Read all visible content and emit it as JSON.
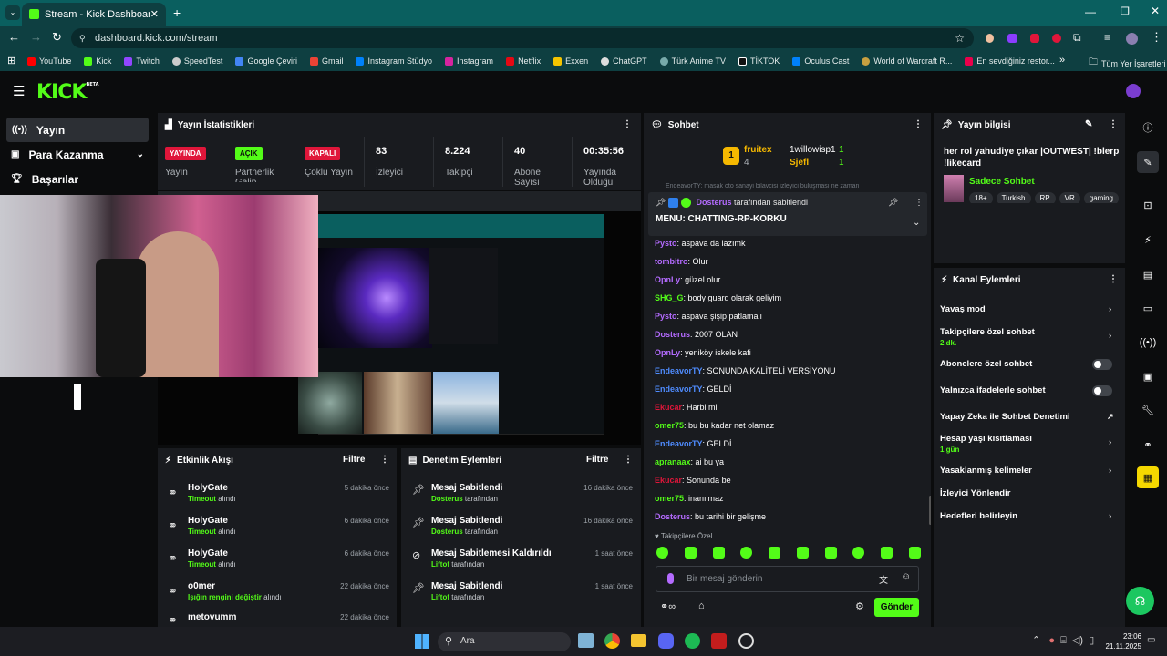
{
  "browser": {
    "tab_title": "Stream - Kick Dashboard",
    "url": "dashboard.kick.com/stream",
    "bookmarks": [
      "YouTube",
      "Kick",
      "Twitch",
      "SpeedTest",
      "Google Çeviri",
      "Gmail",
      "Instagram Stüdyo",
      "Instagram",
      "Netflix",
      "Exxen",
      "ChatGPT",
      "Türk Anime TV",
      "TİKTOK",
      "Oculus Cast",
      "World of Warcraft R...",
      "En sevdiğiniz restor..."
    ],
    "bookmarks_all": "Tüm Yer İşaretleri"
  },
  "app": {
    "logo": "KICK",
    "beta": "BETA"
  },
  "sidebar": {
    "items": [
      {
        "label": "Yayın",
        "icon": "broadcast-icon"
      },
      {
        "label": "Para Kazanma",
        "icon": "money-icon"
      },
      {
        "label": "Başarılar",
        "icon": "trophy-icon"
      }
    ]
  },
  "stats": {
    "title": "Yayın İstatistikleri",
    "items": [
      {
        "badge": "YAYINDA",
        "label": "Yayın",
        "color": "#e0163a"
      },
      {
        "badge": "AÇIK",
        "label": "Partnerlik Galip",
        "color": "#53fc18"
      },
      {
        "badge": "KAPALI",
        "label": "Çoklu Yayın",
        "color": "#e0163a"
      },
      {
        "value": "83",
        "label": "İzleyici"
      },
      {
        "value": "8.224",
        "label": "Takipçi"
      },
      {
        "value": "40",
        "label": "Abone Sayısı"
      },
      {
        "value": "00:35:56",
        "label": "Yayında Olduğu"
      }
    ]
  },
  "activity": {
    "title": "Etkinlik Akışı",
    "filter": "Filtre",
    "items": [
      {
        "user": "HolyGate",
        "action": "Timeout",
        "suffix": "alındı",
        "time": "5 dakika önce"
      },
      {
        "user": "HolyGate",
        "action": "Timeout",
        "suffix": "alındı",
        "time": "6 dakika önce"
      },
      {
        "user": "HolyGate",
        "action": "Timeout",
        "suffix": "alındı",
        "time": "6 dakika önce"
      },
      {
        "user": "o0mer",
        "action": "Işığın rengini değiştir",
        "suffix": "alındı",
        "time": "22 dakika önce"
      },
      {
        "user": "metovumm",
        "action": "",
        "suffix": "",
        "time": "22 dakika önce"
      }
    ]
  },
  "moderation": {
    "title": "Denetim Eylemleri",
    "filter": "Filtre",
    "items": [
      {
        "title": "Mesaj Sabitlendi",
        "by": "Dosterus",
        "suffix": "tarafından",
        "time": "16 dakika önce"
      },
      {
        "title": "Mesaj Sabitlendi",
        "by": "Dosterus",
        "suffix": "tarafından",
        "time": "16 dakika önce"
      },
      {
        "title": "Mesaj Sabitlemesi Kaldırıldı",
        "by": "Liftof",
        "suffix": "tarafından",
        "time": "1 saat önce"
      },
      {
        "title": "Mesaj Sabitlendi",
        "by": "Liftof",
        "suffix": "tarafından",
        "time": "1 saat önce"
      }
    ]
  },
  "chat": {
    "title": "Sohbet",
    "leaders": [
      {
        "rank": "1",
        "name": "fruitex",
        "count": "4"
      },
      {
        "name": "1willowisp1",
        "count": "1"
      },
      {
        "name": "Sjefl",
        "count": "1"
      }
    ],
    "overflow_text": "EndeavorTY: masak oto sanayi bilavcisi izleyici buluşması ne zaman",
    "pinned_by": "Dosterus",
    "pinned_suffix": "tarafından sabitlendi",
    "pinned_text": "MENU: CHATTING-RP-KORKU",
    "messages": [
      {
        "name": "Pysto",
        "color": "#b46bff",
        "text": ": aspava da lazımk"
      },
      {
        "name": "tombitro",
        "color": "#b46bff",
        "text": ": Olur"
      },
      {
        "name": "OpnLy",
        "color": "#b46bff",
        "text": ": güzel olur"
      },
      {
        "name": "SHG_G",
        "color": "#53fc18",
        "text": ": body guard olarak geliyim"
      },
      {
        "name": "Pysto",
        "color": "#b46bff",
        "text": ": aspava şişip patlamalı"
      },
      {
        "name": "Dosterus",
        "color": "#b46bff",
        "text": ": 2007 OLAN"
      },
      {
        "name": "OpnLy",
        "color": "#b46bff",
        "text": ": yeniköy iskele kafi"
      },
      {
        "name": "EndeavorTY",
        "color": "#4f8cff",
        "text": ": SONUNDA KALİTELİ VERSİYONU"
      },
      {
        "name": "EndeavorTY",
        "color": "#4f8cff",
        "text": ": GELDİ"
      },
      {
        "name": "Ekucar",
        "color": "#e0163a",
        "text": ": Harbi mi"
      },
      {
        "name": "omer75",
        "color": "#53fc18",
        "text": ": bu bu kadar net olamaz"
      },
      {
        "name": "EndeavorTY",
        "color": "#4f8cff",
        "text": ": GELDİ"
      },
      {
        "name": "apranaax",
        "color": "#53fc18",
        "text": ": ai bu ya"
      },
      {
        "name": "Ekucar",
        "color": "#e0163a",
        "text": ": Sonunda be"
      },
      {
        "name": "omer75",
        "color": "#53fc18",
        "text": ": inanılmaz"
      },
      {
        "name": "Dosterus",
        "color": "#b46bff",
        "text": ": bu tarihi bir gelişme"
      }
    ],
    "followers_only": "Takipçilere Özel",
    "input_placeholder": "Bir mesaj gönderin",
    "send": "Gönder"
  },
  "stream_info": {
    "title": "Yayın bilgisi",
    "stream_title": "her rol yahudiye çıkar |OUTWEST| !blerp !likecard",
    "category": "Sadece Sohbet",
    "tags": [
      "18+",
      "Turkish",
      "RP",
      "VR",
      "gaming"
    ]
  },
  "channel_actions": {
    "title": "Kanal Eylemleri",
    "items": [
      {
        "label": "Yavaş mod",
        "sub": "",
        "control": "chevron"
      },
      {
        "label": "Takipçilere özel sohbet",
        "sub": "2 dk.",
        "control": "chevron"
      },
      {
        "label": "Abonelere özel sohbet",
        "sub": "",
        "control": "toggle"
      },
      {
        "label": "Yalnızca ifadelerle sohbet",
        "sub": "",
        "control": "toggle"
      },
      {
        "label": "Yapay Zeka ile Sohbet Denetimi",
        "sub": "",
        "control": "external"
      },
      {
        "label": "Hesap yaşı kısıtlaması",
        "sub": "1 gün",
        "control": "chevron"
      },
      {
        "label": "Yasaklanmış kelimeler",
        "sub": "",
        "control": "chevron"
      },
      {
        "label": "İzleyici Yönlendir",
        "sub": "",
        "control": ""
      },
      {
        "label": "Hedefleri belirleyin",
        "sub": "",
        "control": "chevron"
      }
    ]
  },
  "taskbar": {
    "search": "Ara",
    "time": "23:06",
    "date": "21.11.2025"
  },
  "colors": {
    "accent": "#53fc18",
    "live": "#e0163a",
    "panel": "#191b1f",
    "bg": "#0b0c0d",
    "chrome": "#0a5f5f"
  }
}
